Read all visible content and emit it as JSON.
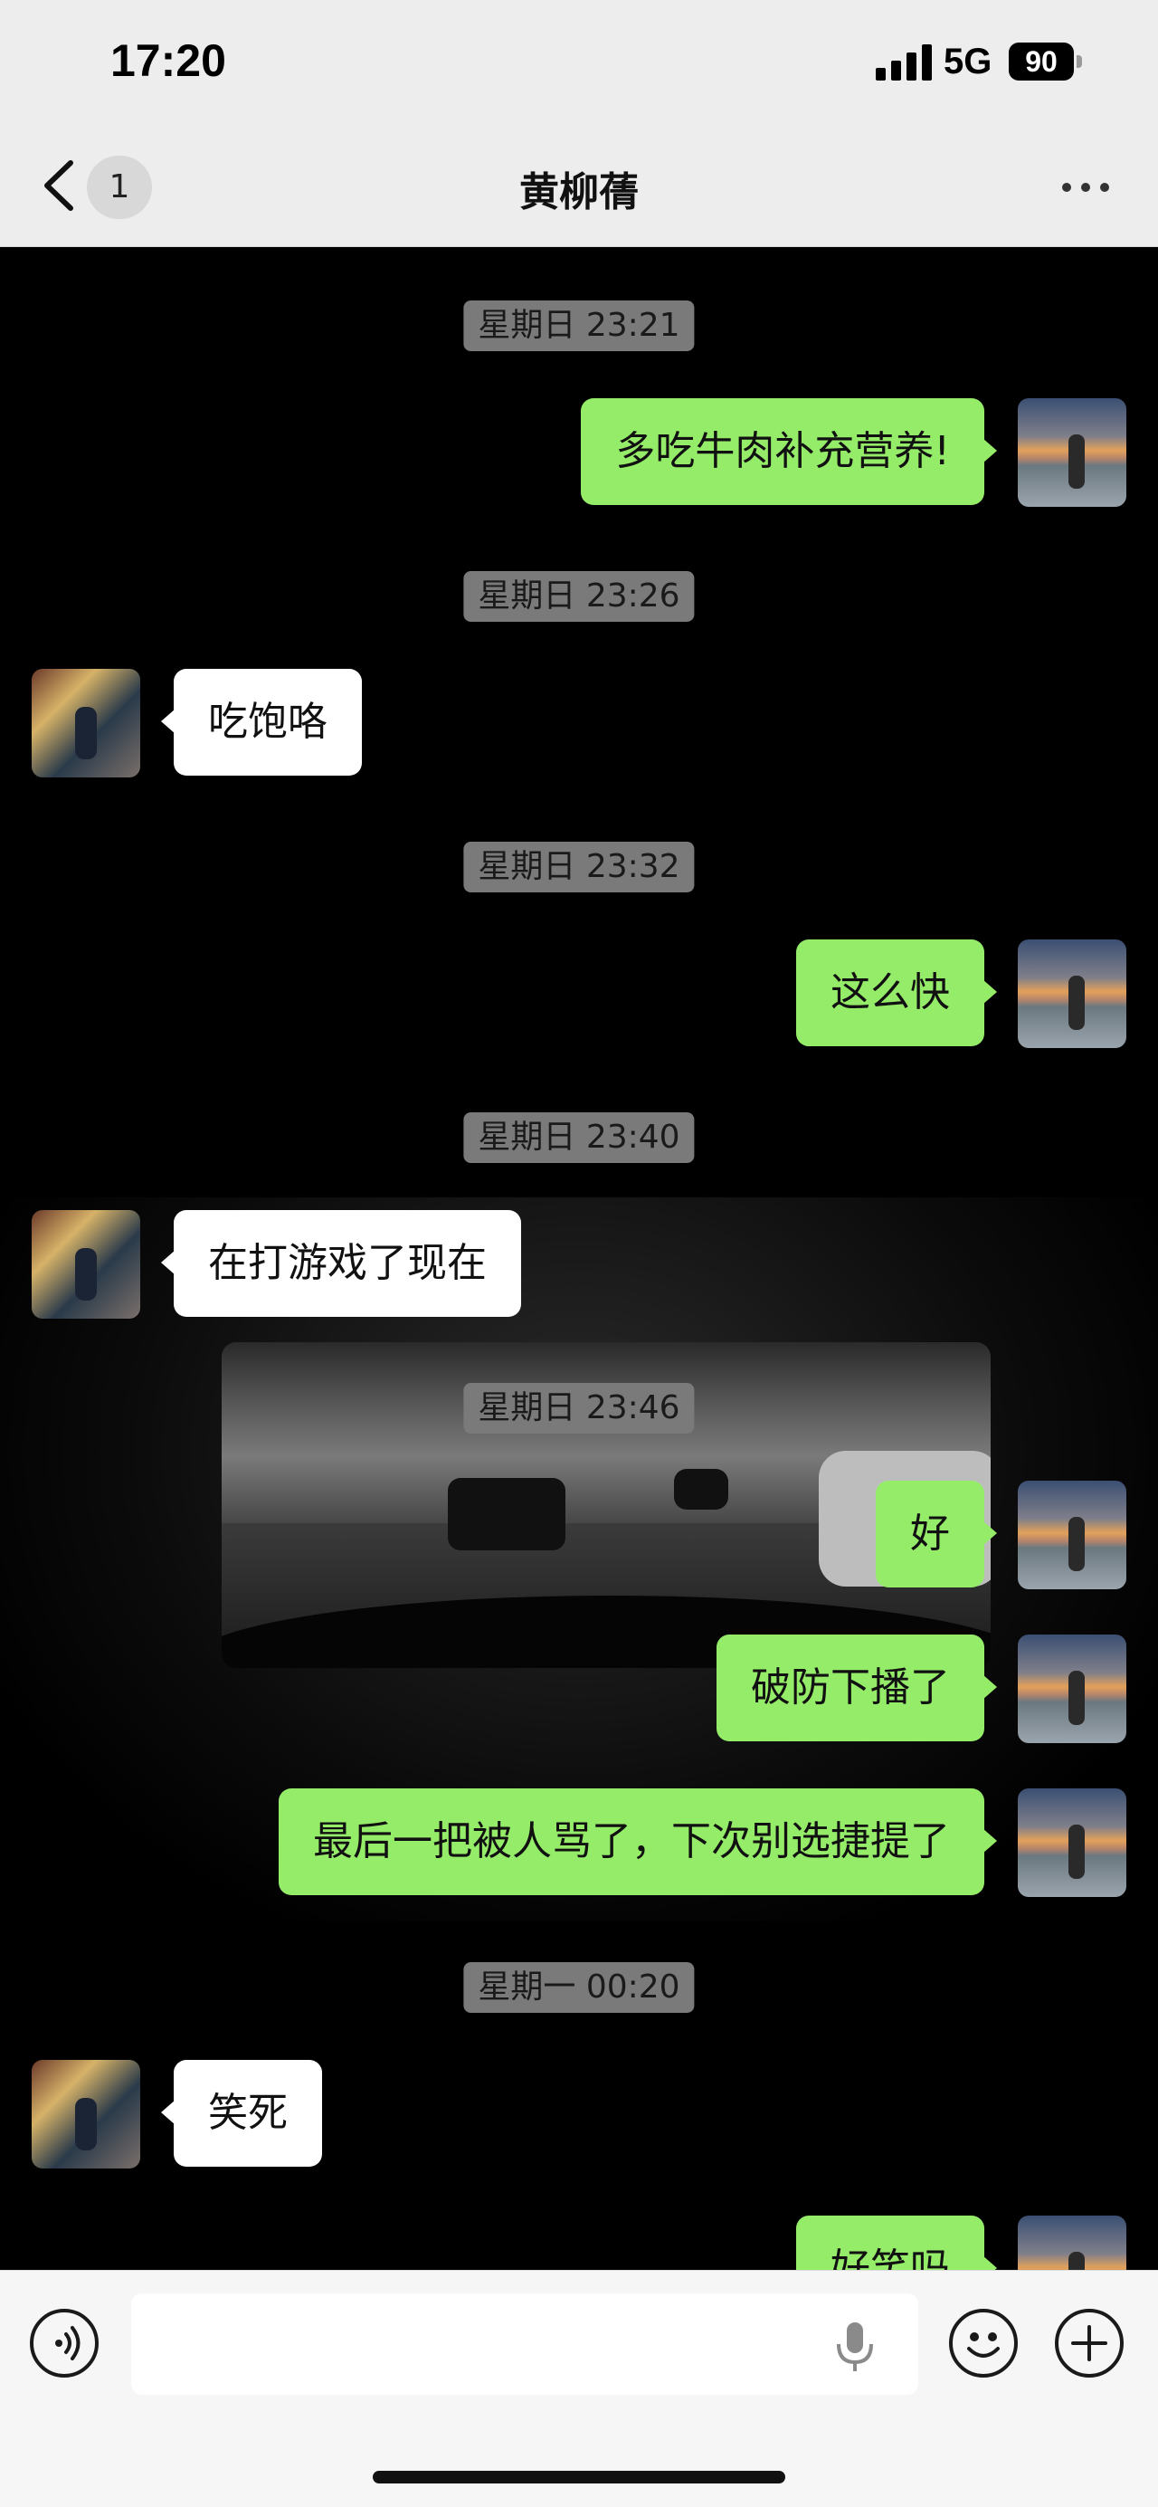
{
  "status_bar": {
    "time": "17:20",
    "network": "5G",
    "battery": "90"
  },
  "header": {
    "back_badge": "1",
    "title": "黄柳蒨"
  },
  "messages": [
    {
      "kind": "time",
      "text": "星期日 23:21"
    },
    {
      "kind": "me",
      "text": "多吃牛肉补充营养!"
    },
    {
      "kind": "time",
      "text": "星期日 23:26"
    },
    {
      "kind": "other",
      "text": "吃饱咯"
    },
    {
      "kind": "time",
      "text": "星期日 23:32"
    },
    {
      "kind": "me",
      "text": "这么快"
    },
    {
      "kind": "time",
      "text": "星期日 23:40"
    },
    {
      "kind": "other",
      "text": "在打游戏了现在"
    },
    {
      "kind": "time",
      "text": "星期日 23:46"
    },
    {
      "kind": "me",
      "text": "好"
    },
    {
      "kind": "me",
      "text": "破防下播了"
    },
    {
      "kind": "me",
      "text": "最后一把被人骂了，下次别选捷提了"
    },
    {
      "kind": "time",
      "text": "星期一 00:20"
    },
    {
      "kind": "other",
      "text": "笑死"
    },
    {
      "kind": "me",
      "text": "好笑吗"
    }
  ],
  "input_bar": {
    "placeholder": ""
  },
  "icons": [
    "back-chevron-icon",
    "more-icon",
    "voice-icon",
    "mic-icon",
    "emoji-icon",
    "plus-icon"
  ],
  "colors": {
    "my_bubble": "#95ec69",
    "their_bubble": "#ffffff",
    "header_bg": "#ededed",
    "chat_bg": "#000000"
  }
}
